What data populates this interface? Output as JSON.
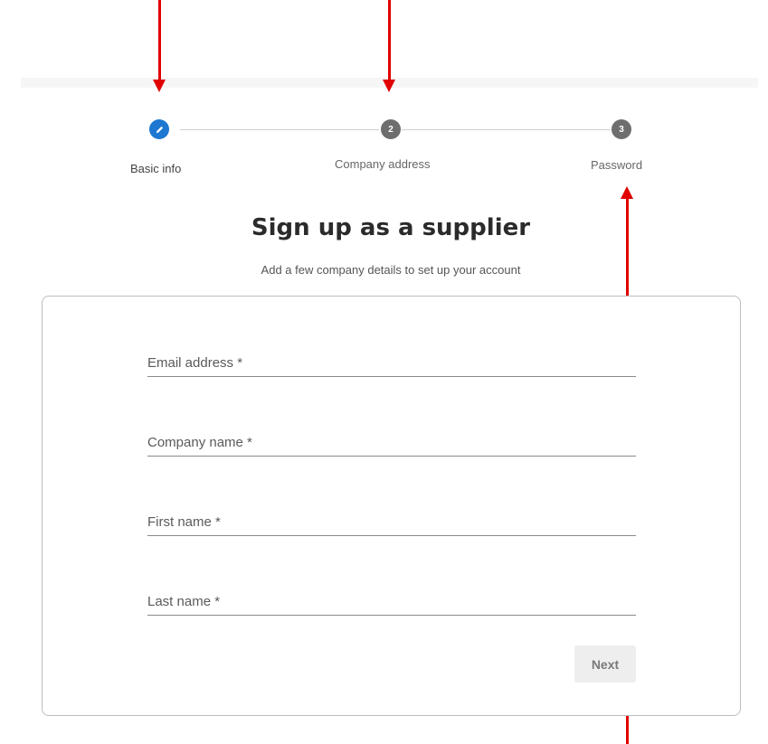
{
  "stepper": {
    "steps": [
      {
        "label": "Basic info",
        "number": "",
        "state": "active",
        "icon": "pencil-icon"
      },
      {
        "label": "Company address",
        "number": "2",
        "state": "inactive"
      },
      {
        "label": "Password",
        "number": "3",
        "state": "inactive"
      }
    ]
  },
  "header": {
    "title": "Sign up as a supplier",
    "subtitle": "Add a few company details to set up your account"
  },
  "form": {
    "fields": [
      {
        "placeholder": "Email address *",
        "value": ""
      },
      {
        "placeholder": "Company name *",
        "value": ""
      },
      {
        "placeholder": "First name *",
        "value": ""
      },
      {
        "placeholder": "Last name *",
        "value": ""
      }
    ],
    "next_label": "Next"
  },
  "annotations": {
    "arrow_color": "#e00000"
  },
  "colors": {
    "active_step": "#1e78d1",
    "inactive_step": "#6e6e6e"
  }
}
